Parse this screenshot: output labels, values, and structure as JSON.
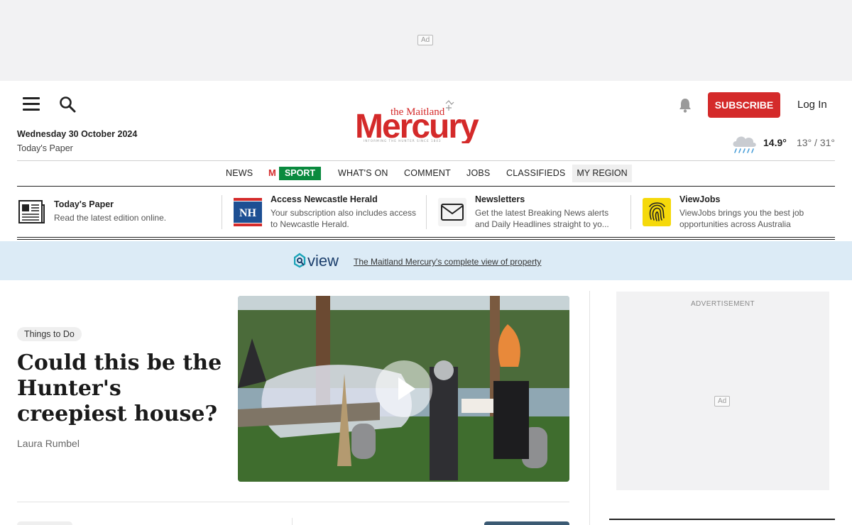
{
  "top_ad": {
    "tag": "Ad"
  },
  "header": {
    "date": "Wednesday 30 October 2024",
    "todays_paper": "Today's Paper",
    "logo_text": "Mercury",
    "logo_subtitle": "the Maitland",
    "logo_tagline": "INFORMING THE HUNTER SINCE 1843",
    "subscribe_label": "SUBSCRIBE",
    "login_label": "Log In",
    "weather": {
      "current": "14.9°",
      "range": "13° / 31°",
      "icon": "rain-cloud-icon"
    },
    "brand_red": "#d42a2a"
  },
  "nav": {
    "items": [
      "NEWS",
      "SPORT",
      "WHAT'S ON",
      "COMMENT",
      "JOBS",
      "CLASSIFIEDS",
      "MY REGION"
    ],
    "sport_badge": "M",
    "sport_color": "#0a8a3e"
  },
  "promos": [
    {
      "title": "Today's Paper",
      "desc": "Read the latest edition online.",
      "icon": "newspaper-icon"
    },
    {
      "title": "Access Newcastle Herald",
      "desc": "Your subscription also includes access to Newcastle Herald.",
      "icon": "nh-logo-icon",
      "badge": "NH"
    },
    {
      "title": "Newsletters",
      "desc": "Get the latest Breaking News alerts and Daily Headlines straight to yo...",
      "icon": "envelope-icon"
    },
    {
      "title": "ViewJobs",
      "desc": "ViewJobs brings you the best job opportunities across Australia",
      "icon": "fingerprint-icon"
    }
  ],
  "view_banner": {
    "logo_text": "view",
    "link": "The Maitland Mercury's complete view of property"
  },
  "article": {
    "category": "Things to Do",
    "headline": "Could this be the Hunter's creepiest house?",
    "author": "Laura Rumbel"
  },
  "side_ad": {
    "label": "ADVERTISEMENT",
    "tag": "Ad"
  }
}
